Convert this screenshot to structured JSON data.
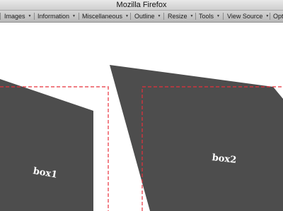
{
  "window": {
    "title": "Mozilla Firefox"
  },
  "toolbar": {
    "items": [
      {
        "label": "Images",
        "icon": "dropdown-arrow-icon"
      },
      {
        "label": "Information",
        "icon": "dropdown-arrow-icon"
      },
      {
        "label": "Miscellaneous",
        "icon": "dropdown-arrow-icon"
      },
      {
        "label": "Outline",
        "icon": "dropdown-arrow-icon"
      },
      {
        "label": "Resize",
        "icon": "dropdown-arrow-icon"
      },
      {
        "label": "Tools",
        "icon": "dropdown-arrow-icon"
      },
      {
        "label": "View Source",
        "icon": "dropdown-arrow-icon"
      },
      {
        "label": "Opt",
        "icon": ""
      }
    ]
  },
  "page": {
    "box1_label": "box1",
    "box2_label": "box2"
  },
  "colors": {
    "box_fill": "#4d4d4d",
    "outline": "#e8303b",
    "label": "#ffffff",
    "background": "#ffffff"
  }
}
